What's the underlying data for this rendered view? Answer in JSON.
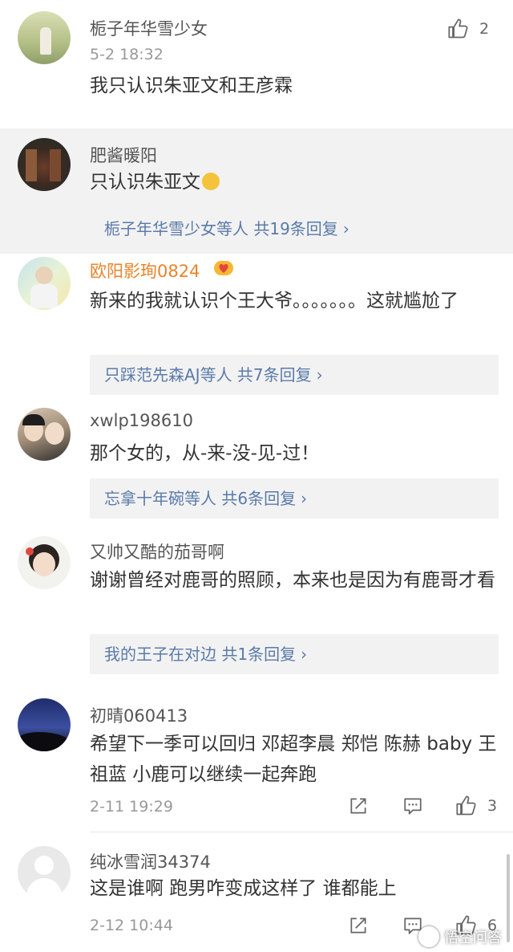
{
  "comments": [
    {
      "username": "栀子年华雪少女",
      "time": "5-2 18:32",
      "text": "我只认识朱亚文和王彦霖",
      "likes": "2"
    },
    {
      "username": "肥酱暖阳",
      "text": "只认识朱亚文",
      "reply": "栀子年华雪少女等人  共19条回复"
    },
    {
      "username": "欧阳影珣0824",
      "text": "新来的我就认识个王大爷。。。。。。。这就尴尬了",
      "reply": "只踩范先森AJ等人  共7条回复"
    },
    {
      "username": "xwlp198610",
      "text": "那个女的，从-来-没-见-过！",
      "reply": "忘拿十年碗等人  共6条回复"
    },
    {
      "username": "又帅又酷的茄哥啊",
      "text": "谢谢曾经对鹿哥的照顾，本来也是因为有鹿哥才看",
      "reply": "我的王子在对边  共1条回复"
    },
    {
      "username": "初晴060413",
      "time": "2-11 19:29",
      "text": "希望下一季可以回归 邓超李晨 郑恺 陈赫 baby 王祖蓝 小鹿可以继续一起奔跑",
      "likes": "3"
    },
    {
      "username": "纯冰雪润34374",
      "time": "2-12 10:44",
      "text": "这是谁啊 跑男咋变成这样了 谁都能上",
      "likes": "6"
    }
  ],
  "icons": {
    "like": "thumbs-up-icon",
    "share": "share-icon",
    "comment": "comment-icon",
    "chevron": "chevron-right-icon",
    "emoji": "laughing-crying-emoji-icon",
    "badge": "heart-badge-icon"
  },
  "colors": {
    "reply_link": "#5a7ba9",
    "highlight_bg": "#f2f2f2",
    "vip_name": "#e8842a"
  },
  "watermark": {
    "text": "悟空问答"
  }
}
